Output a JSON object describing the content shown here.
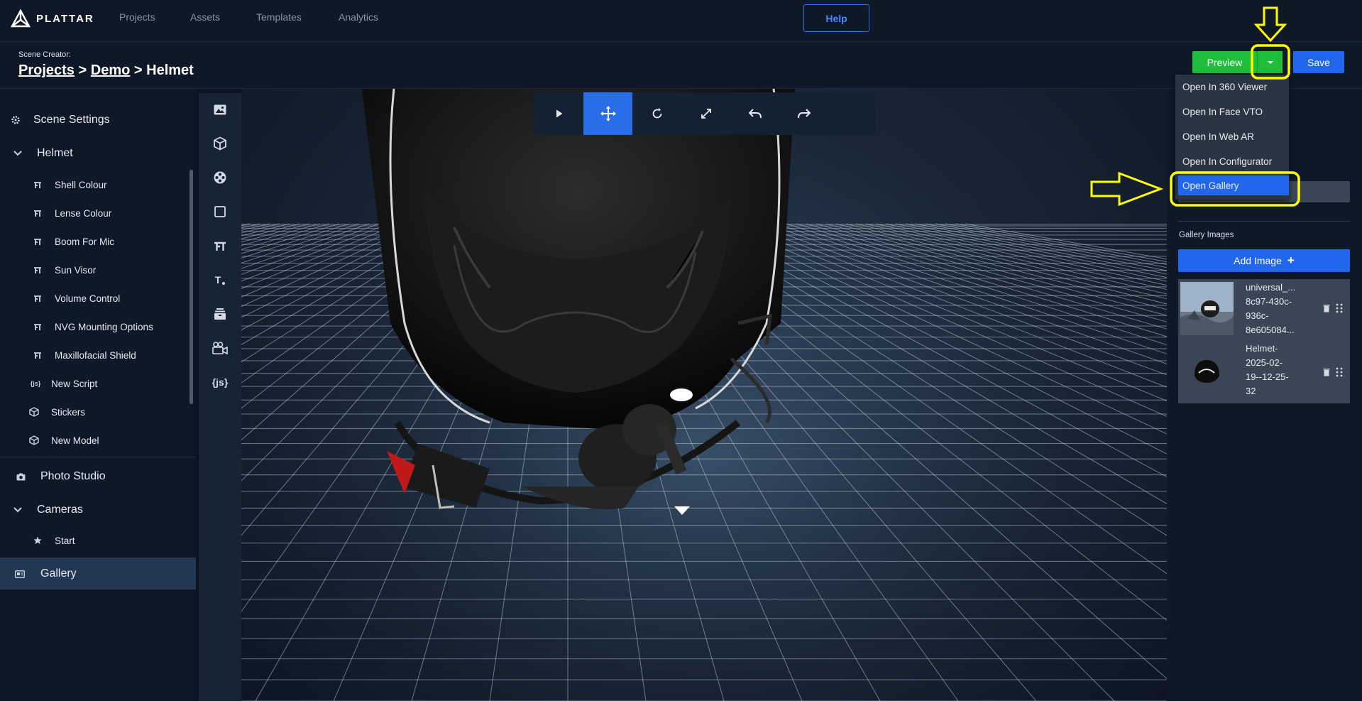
{
  "brand": {
    "name": "PLATTAR"
  },
  "topnav": {
    "links": [
      "Projects",
      "Assets",
      "Templates",
      "Analytics"
    ],
    "help_label": "Help"
  },
  "header": {
    "scene_label": "Scene Creator:",
    "crumbs": [
      "Projects",
      "Demo",
      "Helmet"
    ],
    "separator": ">",
    "preview_label": "Preview",
    "save_label": "Save"
  },
  "sidebar": {
    "scene_settings": "Scene Settings",
    "helmet": "Helmet",
    "variations": [
      "Shell Colour",
      "Lense Colour",
      "Boom For Mic",
      "Sun Visor",
      "Volume Control",
      "NVG Mounting Options",
      "Maxillofacial Shield"
    ],
    "new_script": "New Script",
    "stickers": "Stickers",
    "new_model": "New Model",
    "photo_studio": "Photo Studio",
    "cameras": "Cameras",
    "start": "Start",
    "gallery": "Gallery",
    "script_icon_text": "{js}"
  },
  "toolrail": {
    "icons": [
      "image-icon",
      "cube-icon",
      "film-reel-icon",
      "square-icon",
      "variation-icon",
      "text-icon",
      "stack-icon",
      "camera-icon",
      "script-icon"
    ],
    "script_label": "{js}",
    "text_label": "T"
  },
  "viewport_toolbar": {
    "tools": [
      "play-icon",
      "move-icon",
      "rotate-icon",
      "scale-icon",
      "undo-icon",
      "redo-icon"
    ],
    "active": "move-icon"
  },
  "dropdown": {
    "items": [
      "Open In 360 Viewer",
      "Open In Face VTO",
      "Open In Web AR",
      "Open In Configurator",
      "Open Gallery"
    ],
    "highlighted": "Open Gallery"
  },
  "gallery_panel": {
    "title": "Gallery Images",
    "add_label": "Add Image",
    "add_symbol": "+",
    "images": [
      {
        "name": "universal_...\n8c97-430c-\n936c-\n8e605084..."
      },
      {
        "name": "Helmet-\n2025-02-\n19--12-25-\n32"
      }
    ]
  },
  "colors": {
    "accent": "#2166ec",
    "preview_green": "#1fbf3b",
    "annotation": "#ffff00",
    "sidebar_bg": "#0e1826",
    "active_item": "#223752"
  }
}
